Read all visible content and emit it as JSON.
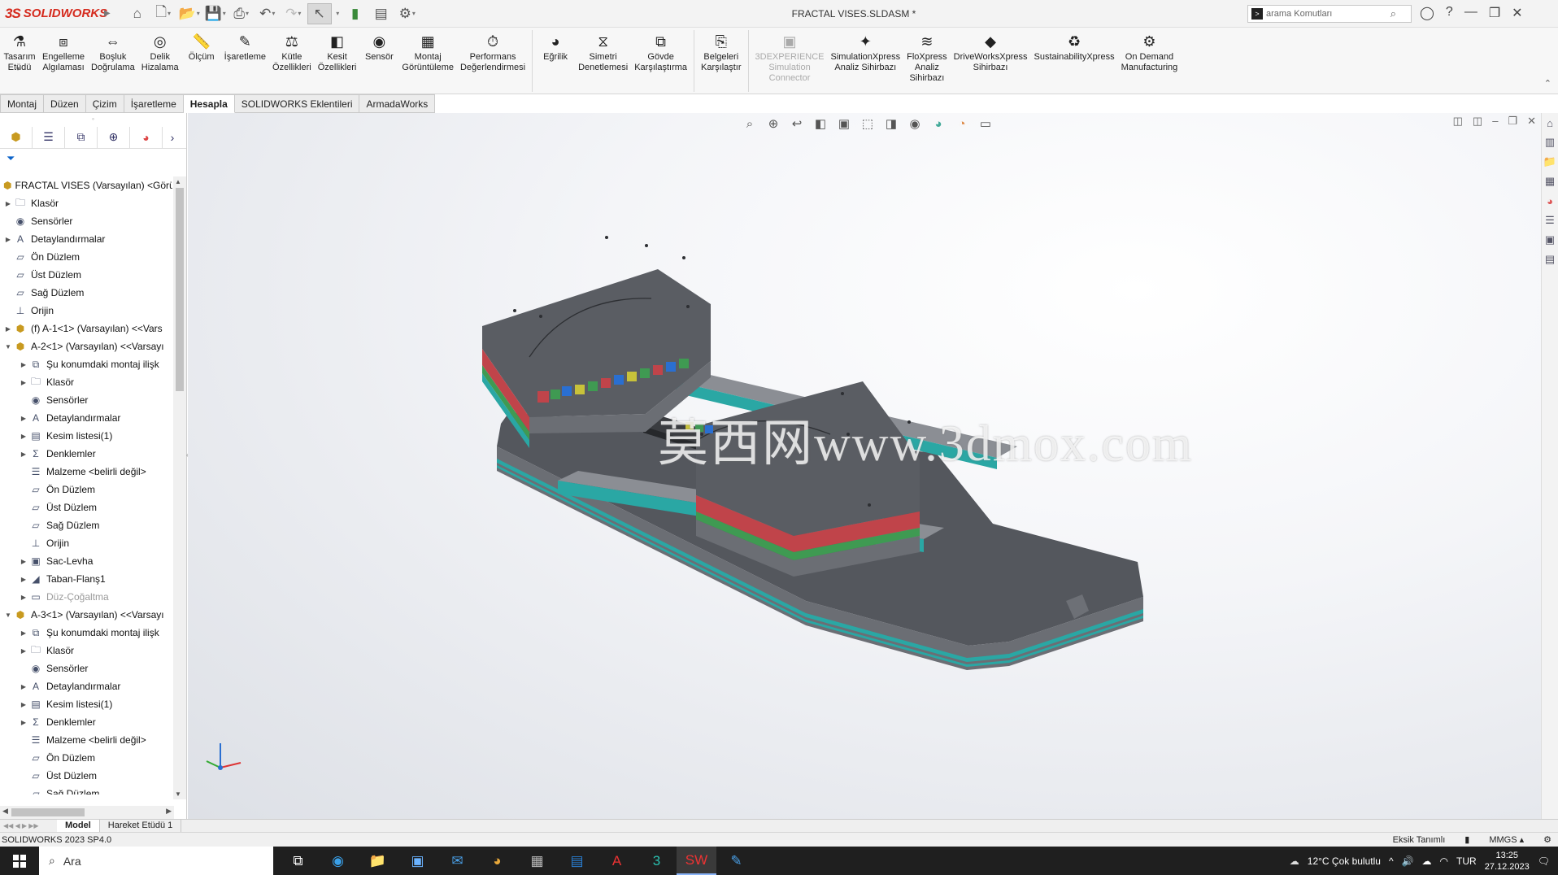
{
  "app": {
    "brand": "SOLIDWORKS",
    "brand_prefix": "3S",
    "document_title": "FRACTAL VISES.SLDASM *"
  },
  "search": {
    "placeholder": "arama Komutları",
    "prompt_icon": ">"
  },
  "ribbon": [
    {
      "label": "Tasarım\nEtüdü",
      "icon": "design-study-icon"
    },
    {
      "label": "Engelleme\nAlgılaması",
      "icon": "interference-icon"
    },
    {
      "label": "Boşluk\nDoğrulama",
      "icon": "clearance-icon"
    },
    {
      "label": "Delik\nHizalama",
      "icon": "hole-align-icon"
    },
    {
      "label": "Ölçüm",
      "icon": "measure-icon"
    },
    {
      "label": "İşaretleme",
      "icon": "markup-icon"
    },
    {
      "label": "Kütle\nÖzellikleri",
      "icon": "mass-icon"
    },
    {
      "label": "Kesit\nÖzellikleri",
      "icon": "section-icon"
    },
    {
      "label": "Sensör",
      "icon": "sensor-icon"
    },
    {
      "label": "Montaj\nGörüntüleme",
      "icon": "assembly-view-icon"
    },
    {
      "label": "Performans\nDeğerlendirmesi",
      "icon": "performance-icon"
    },
    {
      "label": "Eğrilik",
      "icon": "curvature-icon"
    },
    {
      "label": "Simetri\nDenetlemesi",
      "icon": "symmetry-icon"
    },
    {
      "label": "Gövde\nKarşılaştırma",
      "icon": "body-compare-icon"
    },
    {
      "label": "Belgeleri\nKarşılaştır",
      "icon": "doc-compare-icon"
    },
    {
      "label": "3DEXPERIENCE\nSimulation\nConnector",
      "icon": "3dx-icon",
      "disabled": true
    },
    {
      "label": "SimulationXpress\nAnaliz Sihirbazı",
      "icon": "simxpress-icon"
    },
    {
      "label": "FloXpress\nAnaliz\nSihirbazı",
      "icon": "floxpress-icon"
    },
    {
      "label": "DriveWorksXpress\nSihirbazı",
      "icon": "driveworks-icon"
    },
    {
      "label": "SustainabilityXpress",
      "icon": "sustainability-icon"
    },
    {
      "label": "On Demand\nManufacturing",
      "icon": "ondemand-icon"
    }
  ],
  "tabs": [
    {
      "label": "Montaj"
    },
    {
      "label": "Düzen"
    },
    {
      "label": "Çizim"
    },
    {
      "label": "İşaretleme"
    },
    {
      "label": "Hesapla",
      "active": true
    },
    {
      "label": "SOLIDWORKS Eklentileri"
    },
    {
      "label": "ArmadaWorks"
    }
  ],
  "tree": [
    {
      "indent": 0,
      "toggle": "",
      "icon": "assembly-icon",
      "label": "FRACTAL VISES (Varsayılan) <Görün"
    },
    {
      "indent": 0,
      "toggle": "▶",
      "icon": "folder-icon",
      "label": "Klasör"
    },
    {
      "indent": 0,
      "toggle": "",
      "icon": "sensor-icon",
      "label": "Sensörler"
    },
    {
      "indent": 0,
      "toggle": "▶",
      "icon": "annotation-icon",
      "label": "Detaylandırmalar"
    },
    {
      "indent": 0,
      "toggle": "",
      "icon": "plane-icon",
      "label": "Ön Düzlem"
    },
    {
      "indent": 0,
      "toggle": "",
      "icon": "plane-icon",
      "label": "Üst Düzlem"
    },
    {
      "indent": 0,
      "toggle": "",
      "icon": "plane-icon",
      "label": "Sağ Düzlem"
    },
    {
      "indent": 0,
      "toggle": "",
      "icon": "origin-icon",
      "label": "Orijin"
    },
    {
      "indent": 0,
      "toggle": "▶",
      "icon": "component-icon",
      "label": "(f) A-1<1> (Varsayılan) <<Vars"
    },
    {
      "indent": 0,
      "toggle": "▼",
      "icon": "component-icon",
      "label": "A-2<1> (Varsayılan) <<Varsayı"
    },
    {
      "indent": 1,
      "toggle": "▶",
      "icon": "mate-icon",
      "label": "Şu konumdaki montaj ilişk"
    },
    {
      "indent": 1,
      "toggle": "▶",
      "icon": "folder-icon",
      "label": "Klasör"
    },
    {
      "indent": 1,
      "toggle": "",
      "icon": "sensor-icon",
      "label": "Sensörler"
    },
    {
      "indent": 1,
      "toggle": "▶",
      "icon": "annotation-icon",
      "label": "Detaylandırmalar"
    },
    {
      "indent": 1,
      "toggle": "▶",
      "icon": "cutlist-icon",
      "label": "Kesim listesi(1)"
    },
    {
      "indent": 1,
      "toggle": "▶",
      "icon": "equation-icon",
      "label": "Denklemler"
    },
    {
      "indent": 1,
      "toggle": "",
      "icon": "material-icon",
      "label": "Malzeme <belirli değil>"
    },
    {
      "indent": 1,
      "toggle": "",
      "icon": "plane-icon",
      "label": "Ön Düzlem"
    },
    {
      "indent": 1,
      "toggle": "",
      "icon": "plane-icon",
      "label": "Üst Düzlem"
    },
    {
      "indent": 1,
      "toggle": "",
      "icon": "plane-icon",
      "label": "Sağ Düzlem"
    },
    {
      "indent": 1,
      "toggle": "",
      "icon": "origin-icon",
      "label": "Orijin"
    },
    {
      "indent": 1,
      "toggle": "▶",
      "icon": "sheetmetal-icon",
      "label": "Sac-Levha"
    },
    {
      "indent": 1,
      "toggle": "▶",
      "icon": "flange-icon",
      "label": "Taban-Flanş1"
    },
    {
      "indent": 1,
      "toggle": "▶",
      "icon": "flatten-icon",
      "label": "Düz-Çoğaltma",
      "grey": true
    },
    {
      "indent": 0,
      "toggle": "▼",
      "icon": "component-icon",
      "label": "A-3<1> (Varsayılan) <<Varsayı"
    },
    {
      "indent": 1,
      "toggle": "▶",
      "icon": "mate-icon",
      "label": "Şu konumdaki montaj ilişk"
    },
    {
      "indent": 1,
      "toggle": "▶",
      "icon": "folder-icon",
      "label": "Klasör"
    },
    {
      "indent": 1,
      "toggle": "",
      "icon": "sensor-icon",
      "label": "Sensörler"
    },
    {
      "indent": 1,
      "toggle": "▶",
      "icon": "annotation-icon",
      "label": "Detaylandırmalar"
    },
    {
      "indent": 1,
      "toggle": "▶",
      "icon": "cutlist-icon",
      "label": "Kesim listesi(1)"
    },
    {
      "indent": 1,
      "toggle": "▶",
      "icon": "equation-icon",
      "label": "Denklemler"
    },
    {
      "indent": 1,
      "toggle": "",
      "icon": "material-icon",
      "label": "Malzeme <belirli değil>"
    },
    {
      "indent": 1,
      "toggle": "",
      "icon": "plane-icon",
      "label": "Ön Düzlem"
    },
    {
      "indent": 1,
      "toggle": "",
      "icon": "plane-icon",
      "label": "Üst Düzlem"
    },
    {
      "indent": 1,
      "toggle": "",
      "icon": "plane-icon",
      "label": "Sağ Düzlem"
    }
  ],
  "watermark": "莫西网www.3dmox.com",
  "bottom_tabs": [
    {
      "label": "Model",
      "active": true
    },
    {
      "label": "Hareket Etüdü 1"
    }
  ],
  "status": {
    "version": "SOLIDWORKS 2023 SP4.0",
    "definition": "Eksik Tanımlı",
    "units": "MMGS"
  },
  "taskbar": {
    "search_placeholder": "Ara",
    "weather": "12°C  Çok bulutlu",
    "language": "TUR",
    "time": "13:25",
    "date": "27.12.2023"
  },
  "colors": {
    "accent": "#d52b1e",
    "part_dark": "#55585e",
    "part_red": "#c0444a",
    "part_green": "#3f9a52",
    "part_teal": "#2aa7a4",
    "part_yellow": "#c8c23a"
  }
}
